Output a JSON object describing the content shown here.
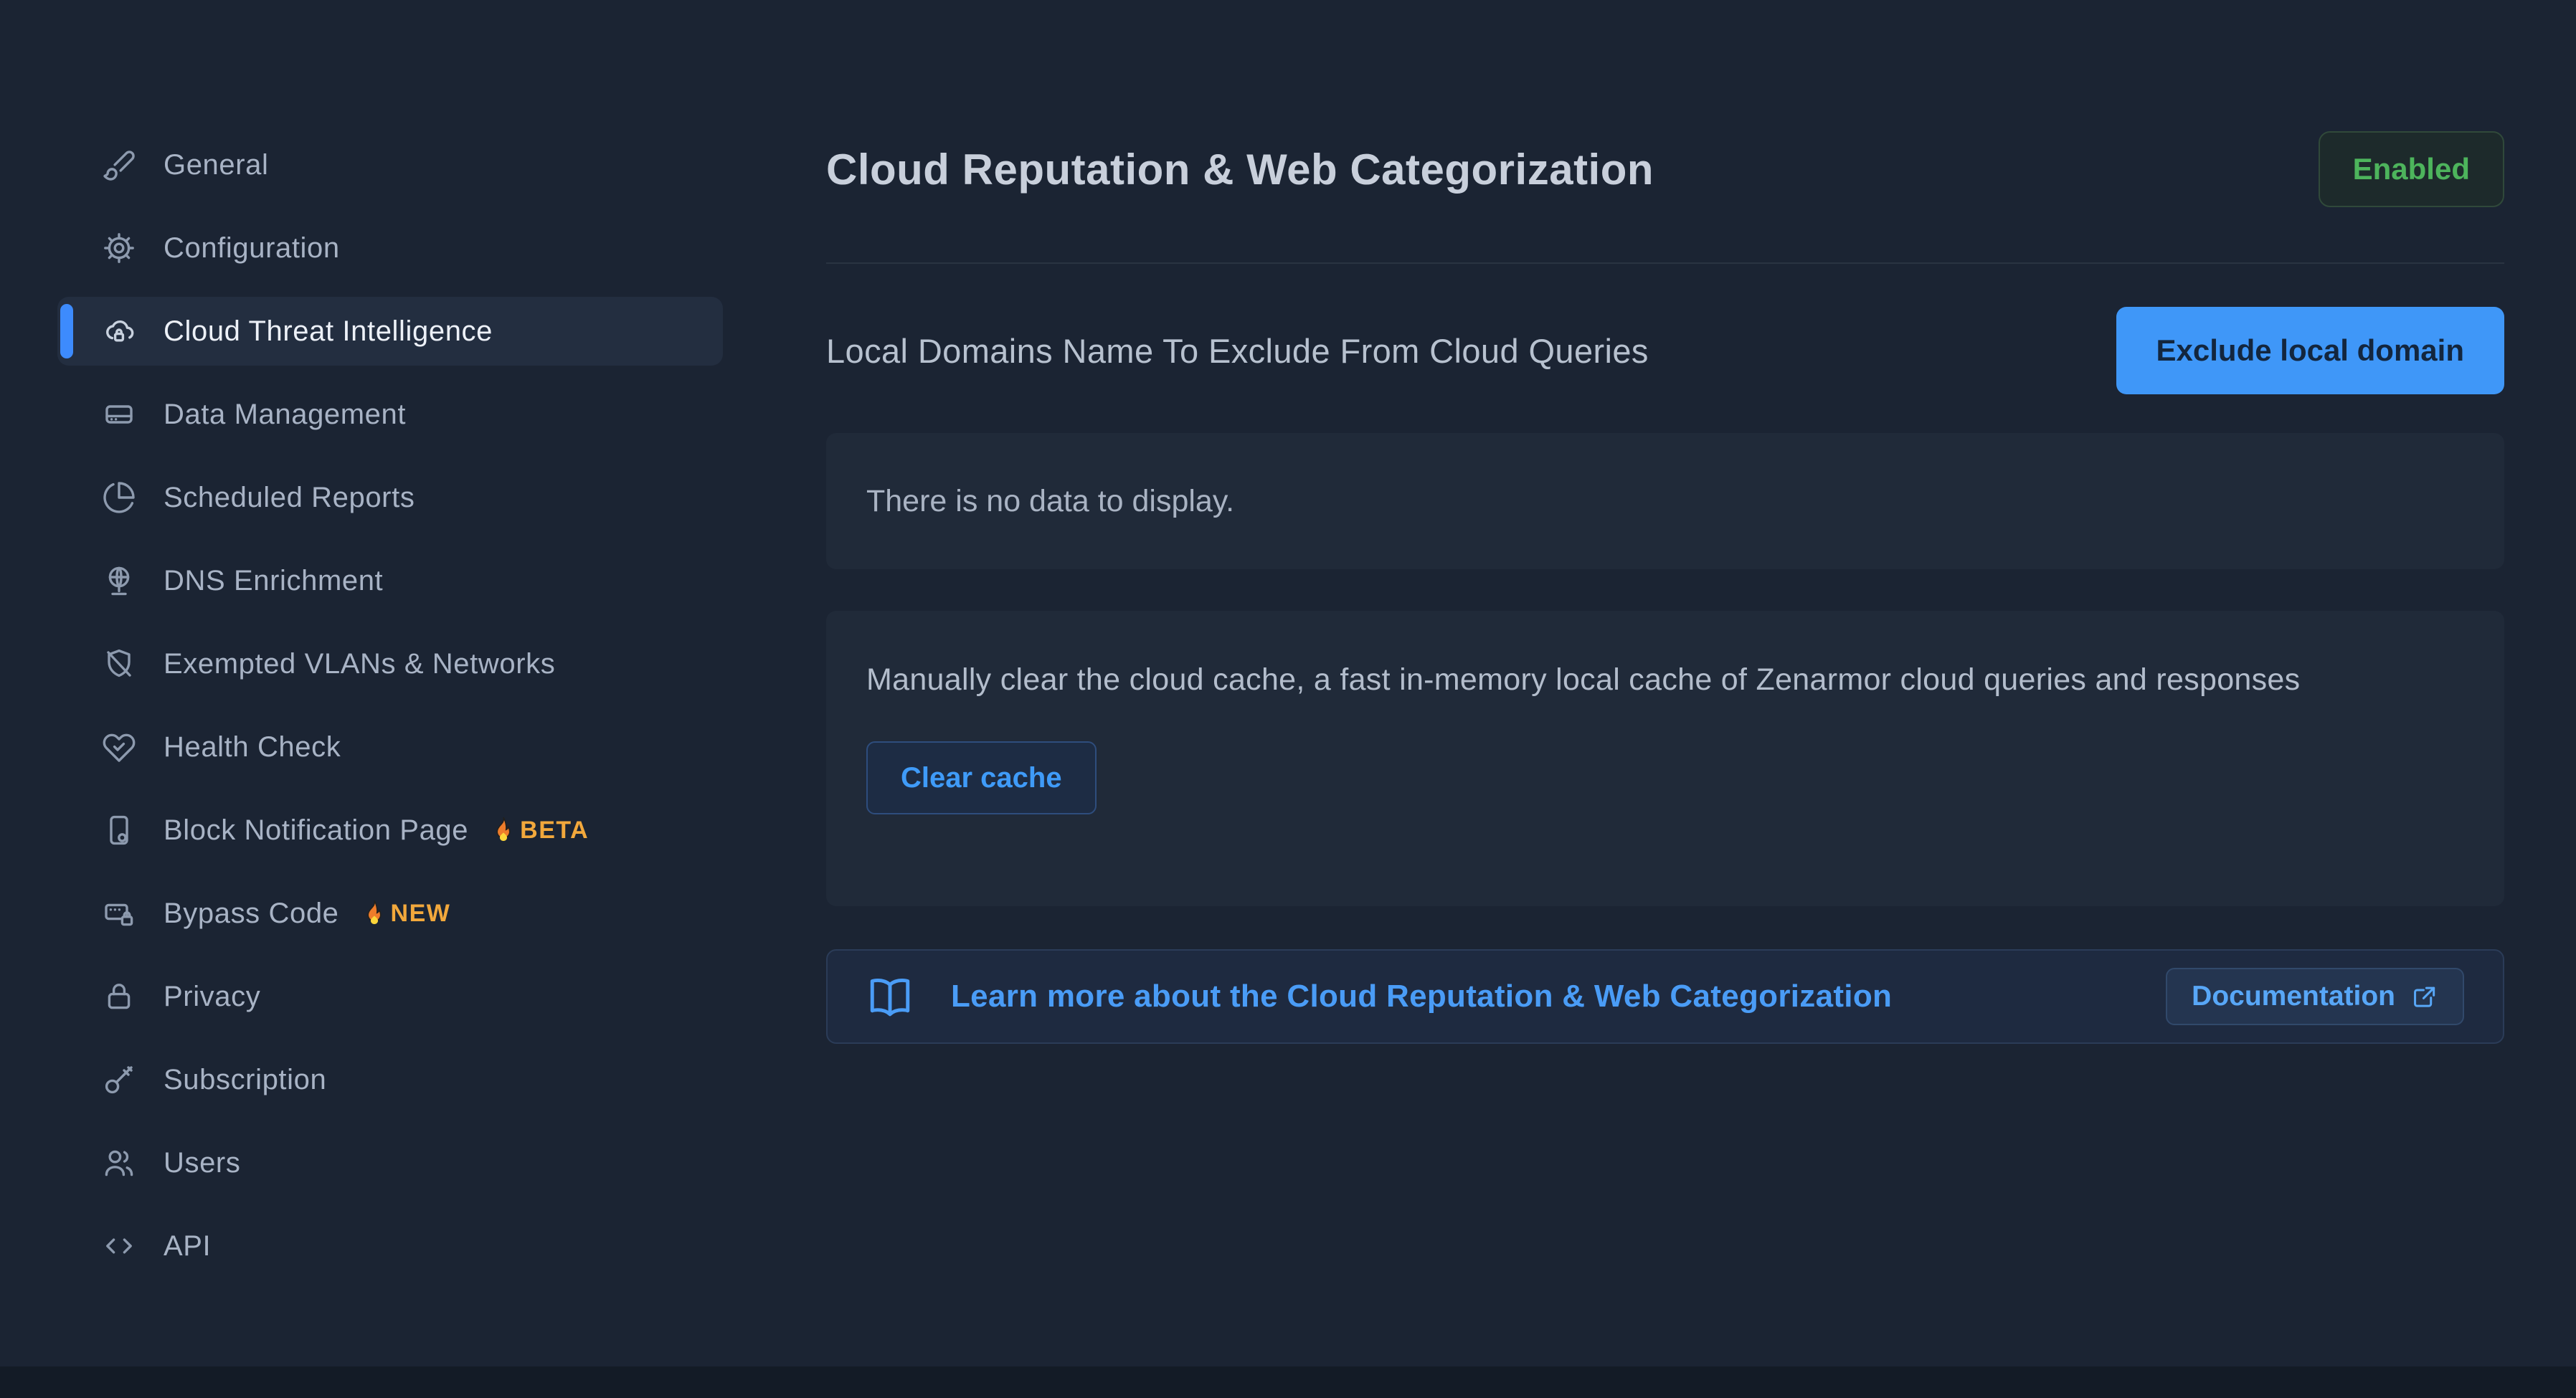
{
  "colors": {
    "background": "#1b2433",
    "panel": "#202a39",
    "sidebar_active_bg": "#232e40",
    "accent_blue": "#3f97f8",
    "link_blue": "#4a9cf6",
    "status_green": "#4db45c",
    "badge_orange": "#f2a83c"
  },
  "sidebar": {
    "items": [
      {
        "label": "General",
        "icon": "paintbrush-icon"
      },
      {
        "label": "Configuration",
        "icon": "gear-icon"
      },
      {
        "label": "Cloud Threat Intelligence",
        "icon": "cloud-lock-icon",
        "active": true
      },
      {
        "label": "Data Management",
        "icon": "hard-drive-icon"
      },
      {
        "label": "Scheduled Reports",
        "icon": "pie-chart-icon"
      },
      {
        "label": "DNS Enrichment",
        "icon": "globe-icon"
      },
      {
        "label": "Exempted VLANs & Networks",
        "icon": "shield-off-icon"
      },
      {
        "label": "Health Check",
        "icon": "heart-check-icon"
      },
      {
        "label": "Block Notification Page",
        "icon": "device-shield-icon",
        "badge": "BETA"
      },
      {
        "label": "Bypass Code",
        "icon": "card-lock-icon",
        "badge": "NEW"
      },
      {
        "label": "Privacy",
        "icon": "lock-icon"
      },
      {
        "label": "Subscription",
        "icon": "key-icon"
      },
      {
        "label": "Users",
        "icon": "users-icon"
      },
      {
        "label": "API",
        "icon": "code-icon"
      }
    ]
  },
  "header": {
    "title": "Cloud Reputation & Web Categorization",
    "status_badge": "Enabled"
  },
  "local_domains": {
    "heading": "Local Domains Name To Exclude From Cloud Queries",
    "exclude_button": "Exclude local domain",
    "empty_message": "There is no data to display."
  },
  "cache": {
    "description": "Manually clear the cloud cache, a fast in-memory local cache of Zenarmor cloud queries and responses",
    "clear_button": "Clear cache"
  },
  "documentation": {
    "learn_more": "Learn more about the Cloud Reputation & Web Categorization",
    "doc_button": "Documentation"
  }
}
